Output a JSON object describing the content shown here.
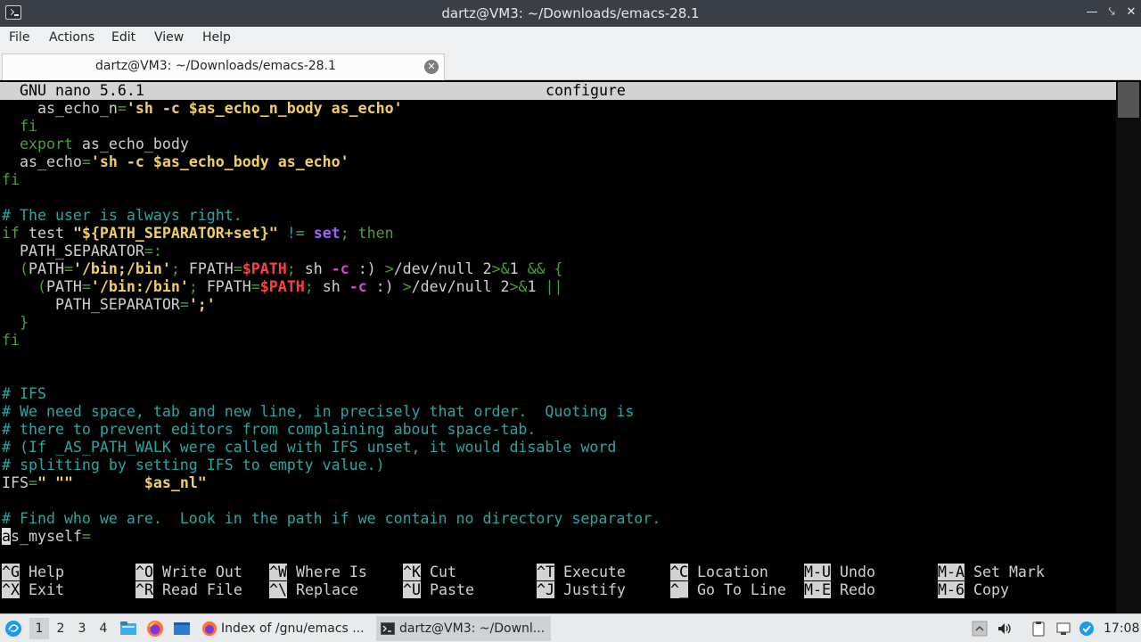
{
  "window": {
    "title": "dartz@VM3: ~/Downloads/emacs-28.1"
  },
  "menu": [
    "File",
    "Actions",
    "Edit",
    "View",
    "Help"
  ],
  "tab": {
    "label": "dartz@VM3: ~/Downloads/emacs-28.1"
  },
  "nano": {
    "version": "GNU nano 5.6.1",
    "filename": "configure"
  },
  "shortcuts": [
    {
      "key": "^G",
      "label": "Help"
    },
    {
      "key": "^O",
      "label": "Write Out"
    },
    {
      "key": "^W",
      "label": "Where Is"
    },
    {
      "key": "^K",
      "label": "Cut"
    },
    {
      "key": "^T",
      "label": "Execute"
    },
    {
      "key": "^C",
      "label": "Location"
    },
    {
      "key": "M-U",
      "label": "Undo"
    },
    {
      "key": "M-A",
      "label": "Set Mark"
    },
    {
      "key": "^X",
      "label": "Exit"
    },
    {
      "key": "^R",
      "label": "Read File"
    },
    {
      "key": "^\\",
      "label": "Replace"
    },
    {
      "key": "^U",
      "label": "Paste"
    },
    {
      "key": "^J",
      "label": "Justify"
    },
    {
      "key": "^_",
      "label": "Go To Line"
    },
    {
      "key": "M-E",
      "label": "Redo"
    },
    {
      "key": "M-6",
      "label": "Copy"
    }
  ],
  "taskbar": {
    "workspaces": [
      "1",
      "2",
      "3",
      "4"
    ],
    "tasks": [
      {
        "label": "Index of /gnu/emacs ..."
      },
      {
        "label": "dartz@VM3: ~/Downl..."
      }
    ],
    "clock": "17:08"
  }
}
